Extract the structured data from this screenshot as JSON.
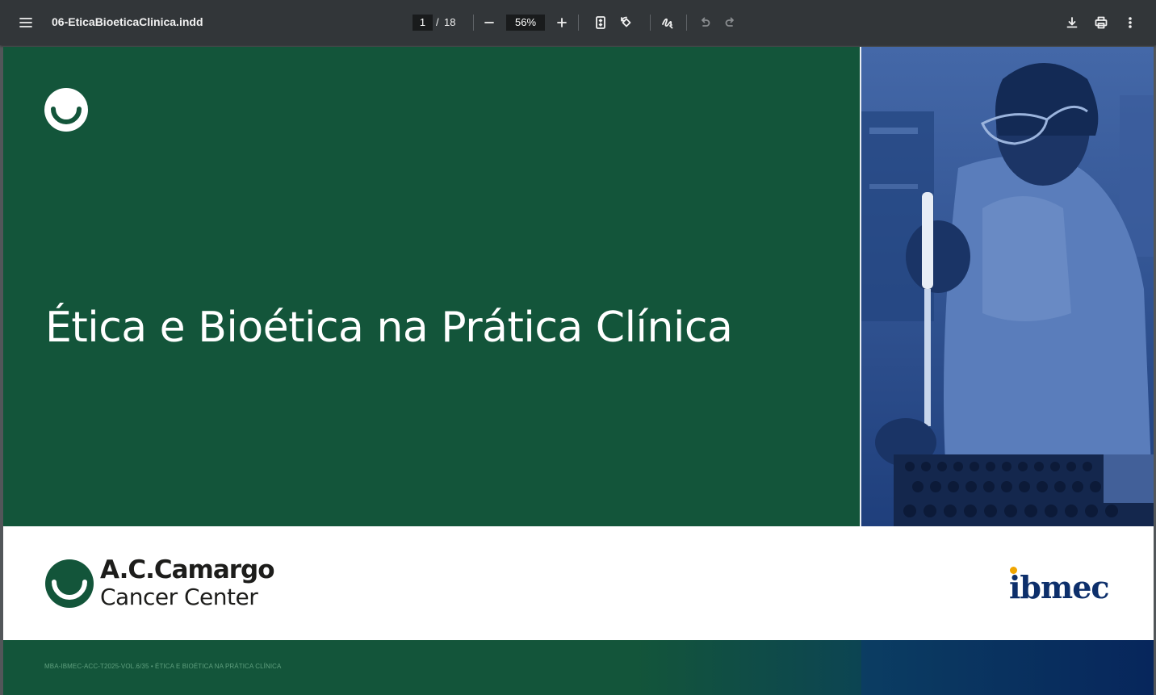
{
  "toolbar": {
    "menu_icon": "hamburger-menu-icon",
    "title": "06-EticaBioeticaClinica.indd",
    "page_current": "1",
    "page_separator": "/",
    "page_total": "18",
    "zoom_value": "56%",
    "icons": [
      "zoom-out-icon",
      "zoom-in-icon",
      "fit-page-icon",
      "rotate-icon",
      "draw-icon",
      "undo-icon",
      "redo-icon",
      "download-icon",
      "print-icon",
      "more-options-icon"
    ]
  },
  "document": {
    "title": "Ética e Bioética na Prática Clínica",
    "brand_name": "A.C.Camargo",
    "brand_sub": "Cancer Center",
    "partner": "ibmec",
    "footer": "MBA-IBMEC-ACC-T2025-VOL.6/35 • ÉTICA E BIOÉTICA NA PRÁTICA CLÍNICA"
  },
  "colors": {
    "toolbar_bg": "#323639",
    "viewer_bg": "#525659",
    "green": "#13553a",
    "photo_blue": "#2b5497",
    "ibmec_navy": "#0d2f6b",
    "ibmec_dot": "#f0a500"
  }
}
